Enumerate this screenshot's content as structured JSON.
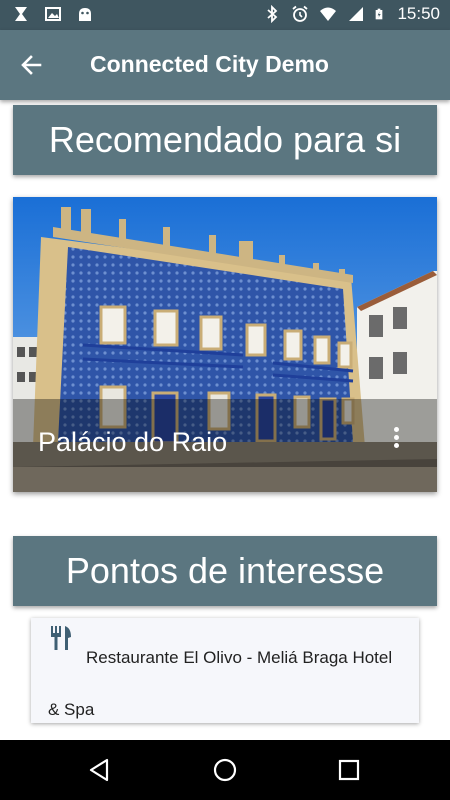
{
  "status_bar": {
    "time": "15:50",
    "left_icons": [
      "x-icon",
      "image-icon",
      "android-icon"
    ],
    "right_icons": [
      "bluetooth-icon",
      "alarm-icon",
      "wifi-icon",
      "signal-icon",
      "battery-icon"
    ]
  },
  "app_bar": {
    "title": "Connected City Demo",
    "back_icon": "arrow-left-icon"
  },
  "recommended": {
    "header": "Recomendado para si",
    "card": {
      "title": "Palácio do Raio",
      "menu_icon": "more-vertical-icon"
    }
  },
  "points_of_interest": {
    "header": "Pontos de interesse",
    "items": [
      {
        "icon": "restaurant-icon",
        "label": "Restaurante El Olivo - Meliá Braga Hotel & Spa"
      }
    ]
  },
  "nav_bar": {
    "icons": [
      "nav-back-icon",
      "nav-home-icon",
      "nav-recents-icon"
    ]
  },
  "colors": {
    "status_bar": "#3f5660",
    "primary": "#5b7680",
    "item_background": "#f6f7fb",
    "restaurant_icon": "#3f5f73"
  }
}
